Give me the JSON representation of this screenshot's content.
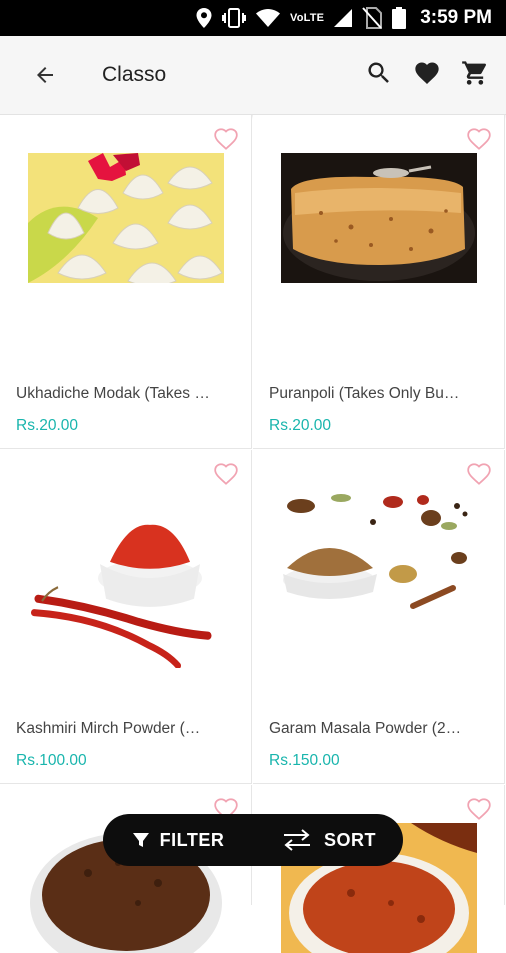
{
  "status_bar": {
    "time": "3:59 PM",
    "network_label": "VoLTE"
  },
  "app_bar": {
    "title": "Classo"
  },
  "products": [
    {
      "name": "Ukhadiche Modak (Takes …",
      "price": "Rs.20.00"
    },
    {
      "name": "Puranpoli (Takes Only Bu…",
      "price": "Rs.20.00"
    },
    {
      "name": "Kashmiri Mirch Powder (…",
      "price": "Rs.100.00"
    },
    {
      "name": "Garam Masala Powder (2…",
      "price": "Rs.150.00"
    }
  ],
  "bottom_actions": {
    "filter_label": "FILTER",
    "sort_label": "SORT"
  },
  "colors": {
    "accent": "#19b5ad",
    "heart_outline": "#f1a3b2",
    "fab_background": "#0d0d0d"
  },
  "icons": [
    "location-icon",
    "vibrate-icon",
    "wifi-icon",
    "signal-icon",
    "no-sim-icon",
    "battery-icon",
    "back-arrow-icon",
    "search-icon",
    "heart-icon",
    "cart-icon",
    "heart-outline-icon",
    "filter-icon",
    "sort-icon"
  ]
}
